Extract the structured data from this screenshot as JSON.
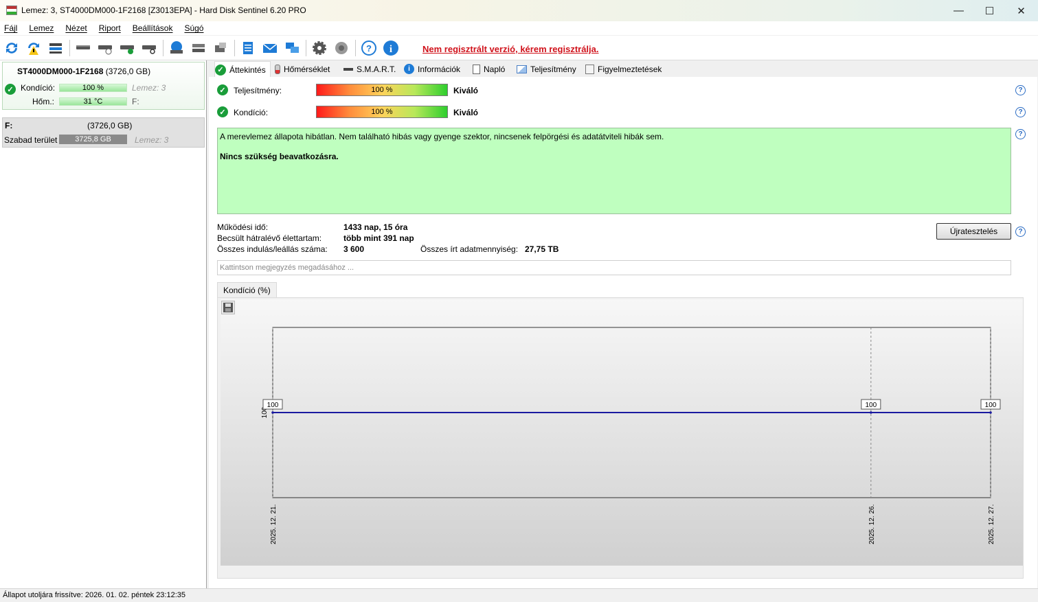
{
  "window": {
    "title": "Lemez: 3, ST4000DM000-1F2168 [Z3013EPA]  -  Hard Disk Sentinel 6.20 PRO",
    "controls": {
      "minimize": "—",
      "maximize": "☐",
      "close": "✕"
    }
  },
  "menu": [
    "Fájl",
    "Lemez",
    "Nézet",
    "Riport",
    "Beállítások",
    "Súgó"
  ],
  "toolbar": {
    "unregistered_notice": "Nem regisztrált verzió, kérem regisztrálja.",
    "icons": [
      "refresh-icon",
      "refresh-warning-icon",
      "disk-list-icon",
      "disk-icon",
      "disk-clock-icon",
      "disk-check-icon",
      "disk-search-icon",
      "globe-disk-icon",
      "network-disk-icon",
      "disk-tools-icon",
      "notes-icon",
      "mail-icon",
      "network-icon",
      "settings-gear-icon",
      "sound-icon",
      "help-icon",
      "info-icon"
    ]
  },
  "left": {
    "disk_name": "ST4000DM000-1F2168",
    "disk_size": "(3726,0 GB)",
    "condition_label": "Kondíció:",
    "condition_value": "100 %",
    "condition_level": 1.0,
    "disk_ref": "Lemez: 3",
    "temp_label": "Hőm.:",
    "temp_value": "31 °C",
    "temp_drive": "F:",
    "partition_name": "F:",
    "partition_size": "(3726,0 GB)",
    "free_label": "Szabad terület",
    "free_value": "3725,8 GB",
    "partition_disk_ref": "Lemez: 3"
  },
  "tabs": [
    "Áttekintés",
    "Hőmérséklet",
    "S.M.A.R.T.",
    "Információk",
    "Napló",
    "Teljesítmény",
    "Figyelmeztetések"
  ],
  "overview": {
    "performance_label": "Teljesítmény:",
    "performance_value": "100 %",
    "performance_rating": "Kiváló",
    "condition_label": "Kondíció:",
    "condition_value": "100 %",
    "condition_rating": "Kiváló",
    "status_text": "A merevlemez állapota hibátlan. Nem található hibás vagy gyenge szektor, nincsenek felpörgési és adatátviteli hibák sem.",
    "status_action": "Nincs szükség beavatkozásra.",
    "uptime_label": "Működési idő:",
    "uptime_value": "1433 nap, 15 óra",
    "lifetime_label": "Becsült hátralévő élettartam:",
    "lifetime_value": "több mint 391 nap",
    "starts_label": "Összes indulás/leállás száma:",
    "starts_value": "3 600",
    "written_label": "Összes írt adatmennyiség:",
    "written_value": "27,75 TB",
    "retest_button": "Újratesztelés",
    "note_placeholder": "Kattintson megjegyzés megadásához ..."
  },
  "chart_tab": "Kondíció  (%)",
  "chart_data": {
    "type": "line",
    "x": [
      "2025. 12. 21.",
      "2025. 12. 26.",
      "2025. 12. 27."
    ],
    "x_days": [
      0,
      5,
      6
    ],
    "series": [
      {
        "values": [
          100,
          100,
          100
        ]
      }
    ],
    "data_labels": [
      "100",
      "100",
      "100"
    ],
    "ytick": "100",
    "line_color": "#1a1aa0"
  },
  "statusbar": "Állapot utoljára frissítve: 2026. 01. 02. péntek 23:12:35"
}
